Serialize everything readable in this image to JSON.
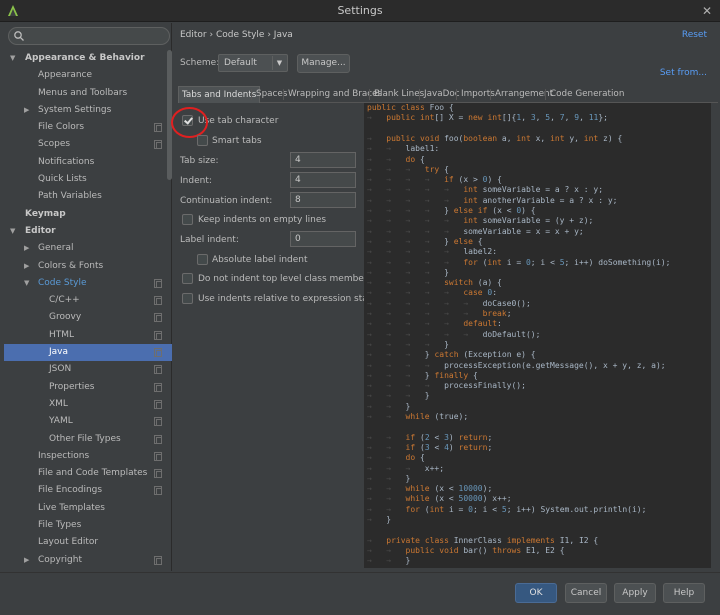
{
  "window": {
    "title": "Settings",
    "close_glyph": "✕",
    "app_icon": "android-studio-icon"
  },
  "sidebar": {
    "search_placeholder": "",
    "items": [
      {
        "label": "Appearance & Behavior",
        "level": 0,
        "arrow": "▼",
        "bold": true
      },
      {
        "label": "Appearance",
        "level": 2
      },
      {
        "label": "Menus and Toolbars",
        "level": 2
      },
      {
        "label": "System Settings",
        "level": 1,
        "arrow": "▶"
      },
      {
        "label": "File Colors",
        "level": 2,
        "proj": true
      },
      {
        "label": "Scopes",
        "level": 2,
        "proj": true
      },
      {
        "label": "Notifications",
        "level": 2
      },
      {
        "label": "Quick Lists",
        "level": 2
      },
      {
        "label": "Path Variables",
        "level": 2
      },
      {
        "label": "Keymap",
        "level": 0,
        "bold": true
      },
      {
        "label": "Editor",
        "level": 0,
        "arrow": "▼",
        "bold": true
      },
      {
        "label": "General",
        "level": 1,
        "arrow": "▶"
      },
      {
        "label": "Colors & Fonts",
        "level": 1,
        "arrow": "▶"
      },
      {
        "label": "Code Style",
        "level": 1,
        "arrow": "▼",
        "blue": true,
        "proj": true
      },
      {
        "label": "C/C++",
        "level": 3,
        "proj": true
      },
      {
        "label": "Groovy",
        "level": 3,
        "proj": true
      },
      {
        "label": "HTML",
        "level": 3,
        "proj": true
      },
      {
        "label": "Java",
        "level": 3,
        "proj": true,
        "selected": true
      },
      {
        "label": "JSON",
        "level": 3,
        "proj": true
      },
      {
        "label": "Properties",
        "level": 3,
        "proj": true
      },
      {
        "label": "XML",
        "level": 3,
        "proj": true
      },
      {
        "label": "YAML",
        "level": 3,
        "proj": true
      },
      {
        "label": "Other File Types",
        "level": 3,
        "proj": true
      },
      {
        "label": "Inspections",
        "level": 2,
        "proj": true
      },
      {
        "label": "File and Code Templates",
        "level": 2,
        "proj": true
      },
      {
        "label": "File Encodings",
        "level": 2,
        "proj": true
      },
      {
        "label": "Live Templates",
        "level": 2
      },
      {
        "label": "File Types",
        "level": 2
      },
      {
        "label": "Layout Editor",
        "level": 2
      },
      {
        "label": "Copyright",
        "level": 1,
        "arrow": "▶",
        "proj": true
      }
    ]
  },
  "header": {
    "breadcrumb": "Editor › Code Style › Java",
    "reset": "Reset"
  },
  "scheme": {
    "label": "Scheme:",
    "value": "Default",
    "manage": "Manage...",
    "set_from": "Set from..."
  },
  "tabs": [
    "Tabs and Indents",
    "Spaces",
    "Wrapping and Braces",
    "Blank Lines",
    "JavaDoc",
    "Imports",
    "Arrangement",
    "Code Generation"
  ],
  "options": {
    "use_tab_character": {
      "label": "Use tab character",
      "checked": true
    },
    "smart_tabs": {
      "label": "Smart tabs",
      "checked": false
    },
    "tab_size": {
      "label": "Tab size:",
      "value": "4"
    },
    "indent": {
      "label": "Indent:",
      "value": "4"
    },
    "continuation_indent": {
      "label": "Continuation indent:",
      "value": "8"
    },
    "keep_indents": {
      "label": "Keep indents on empty lines",
      "checked": false
    },
    "label_indent": {
      "label": "Label indent:",
      "value": "0"
    },
    "absolute_label_indent": {
      "label": "Absolute label indent",
      "checked": false
    },
    "no_indent_top_level": {
      "label": "Do not indent top level class members",
      "checked": false
    },
    "indents_relative": {
      "label": "Use indents relative to expression start",
      "checked": false
    }
  },
  "code_lines": [
    "public class Foo {",
    "\tpublic int[] X = new int[]{1, 3, 5, 7, 9, 11};",
    "",
    "\tpublic void foo(boolean a, int x, int y, int z) {",
    "\t\tlabel1:",
    "\t\tdo {",
    "\t\t\ttry {",
    "\t\t\t\tif (x > 0) {",
    "\t\t\t\t\tint someVariable = a ? x : y;",
    "\t\t\t\t\tint anotherVariable = a ? x : y;",
    "\t\t\t\t} else if (x < 0) {",
    "\t\t\t\t\tint someVariable = (y + z);",
    "\t\t\t\t\tsomeVariable = x = x + y;",
    "\t\t\t\t} else {",
    "\t\t\t\t\tlabel2:",
    "\t\t\t\t\tfor (int i = 0; i < 5; i++) doSomething(i);",
    "\t\t\t\t}",
    "\t\t\t\tswitch (a) {",
    "\t\t\t\t\tcase 0:",
    "\t\t\t\t\t\tdoCase0();",
    "\t\t\t\t\t\tbreak;",
    "\t\t\t\t\tdefault:",
    "\t\t\t\t\t\tdoDefault();",
    "\t\t\t\t}",
    "\t\t\t} catch (Exception e) {",
    "\t\t\t\tprocessException(e.getMessage(), x + y, z, a);",
    "\t\t\t} finally {",
    "\t\t\t\tprocessFinally();",
    "\t\t\t}",
    "\t\t}",
    "\t\twhile (true);",
    "",
    "\t\tif (2 < 3) return;",
    "\t\tif (3 < 4) return;",
    "\t\tdo {",
    "\t\t\tx++;",
    "\t\t}",
    "\t\twhile (x < 10000);",
    "\t\twhile (x < 50000) x++;",
    "\t\tfor (int i = 0; i < 5; i++) System.out.println(i);",
    "\t}",
    "",
    "\tprivate class InnerClass implements I1, I2 {",
    "\t\tpublic void bar() throws E1, E2 {",
    "\t\t}"
  ],
  "buttons": {
    "ok": "OK",
    "cancel": "Cancel",
    "apply": "Apply",
    "help": "Help"
  },
  "colors": {
    "background": "#3c3f41",
    "selection": "#4b6eaf",
    "link": "#589df6",
    "keyword": "#cc7832",
    "number": "#6897bb",
    "annotation_circle": "#e02020"
  }
}
